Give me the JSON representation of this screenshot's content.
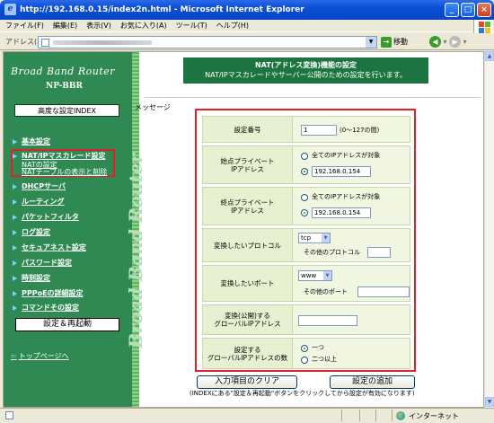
{
  "window": {
    "title": "http://192.168.0.15/index2n.html - Microsoft Internet Explorer",
    "minimize": "_",
    "maximize": "□",
    "close": "×"
  },
  "menu": [
    "ファイル(F)",
    "編集(E)",
    "表示(V)",
    "お気に入り(A)",
    "ツール(T)",
    "ヘルプ(H)"
  ],
  "address": {
    "label": "アドレス(D)",
    "go": "移動"
  },
  "status": {
    "zone": "インターネット"
  },
  "sidebar": {
    "brand": "Broad Band Router",
    "model": "NP-BBR",
    "advanced_index": "高度な設定INDEX",
    "items": [
      {
        "label": "基本設定"
      },
      {
        "label": "NAT/IPマスカレード設定"
      },
      {
        "label": "DHCPサーバ"
      },
      {
        "label": "ルーティング"
      },
      {
        "label": "パケットフィルタ"
      },
      {
        "label": "ログ設定"
      },
      {
        "label": "セキュアネスト設定"
      },
      {
        "label": "パスワード設定"
      },
      {
        "label": "時刻設定"
      },
      {
        "label": "PPPoEの詳細設定"
      },
      {
        "label": "コマンドその設定"
      }
    ],
    "sub_items": [
      "NATの設定",
      "NATテーブルの表示と削除"
    ],
    "restart_button": "設定＆再起動",
    "top_link": "トップページへ"
  },
  "main": {
    "header_title": "NAT(アドレス変換)機能の設定",
    "header_subtitle": "NAT/IPマスカレードやサーバー公開のための設定を行います。",
    "message_label": "メッセージ",
    "watermark": "Broad Band Router",
    "form": {
      "number_label": "設定番号",
      "number_value": "1",
      "number_range": "(0〜127の間)",
      "start_label": "始点プライベート\nIPアドレス",
      "start_all": "全てのIPアドレスが対象",
      "start_ip": "192.168.0.154",
      "end_label": "終点プライベート\nIPアドレス",
      "end_all": "全てのIPアドレスが対象",
      "end_ip": "192.168.0.154",
      "protocol_label": "変換したいプロトコル",
      "protocol_value": "tcp",
      "protocol_other": "その他のプロトコル",
      "port_label": "変換したいポート",
      "port_value": "www",
      "port_other": "その他のポート",
      "global_ip_label": "変換(公開)する\nグローバルIPアドレス",
      "global_count_label": "設定する\nグローバルIPアドレスの数",
      "count_one": "一つ",
      "count_two": "二つ以上"
    },
    "clear_button": "入力項目のクリア",
    "add_button": "設定の追加",
    "note": "(INDEXにある\"設定＆再起動\"ボタンをクリックしてから設定が有効になります)"
  }
}
